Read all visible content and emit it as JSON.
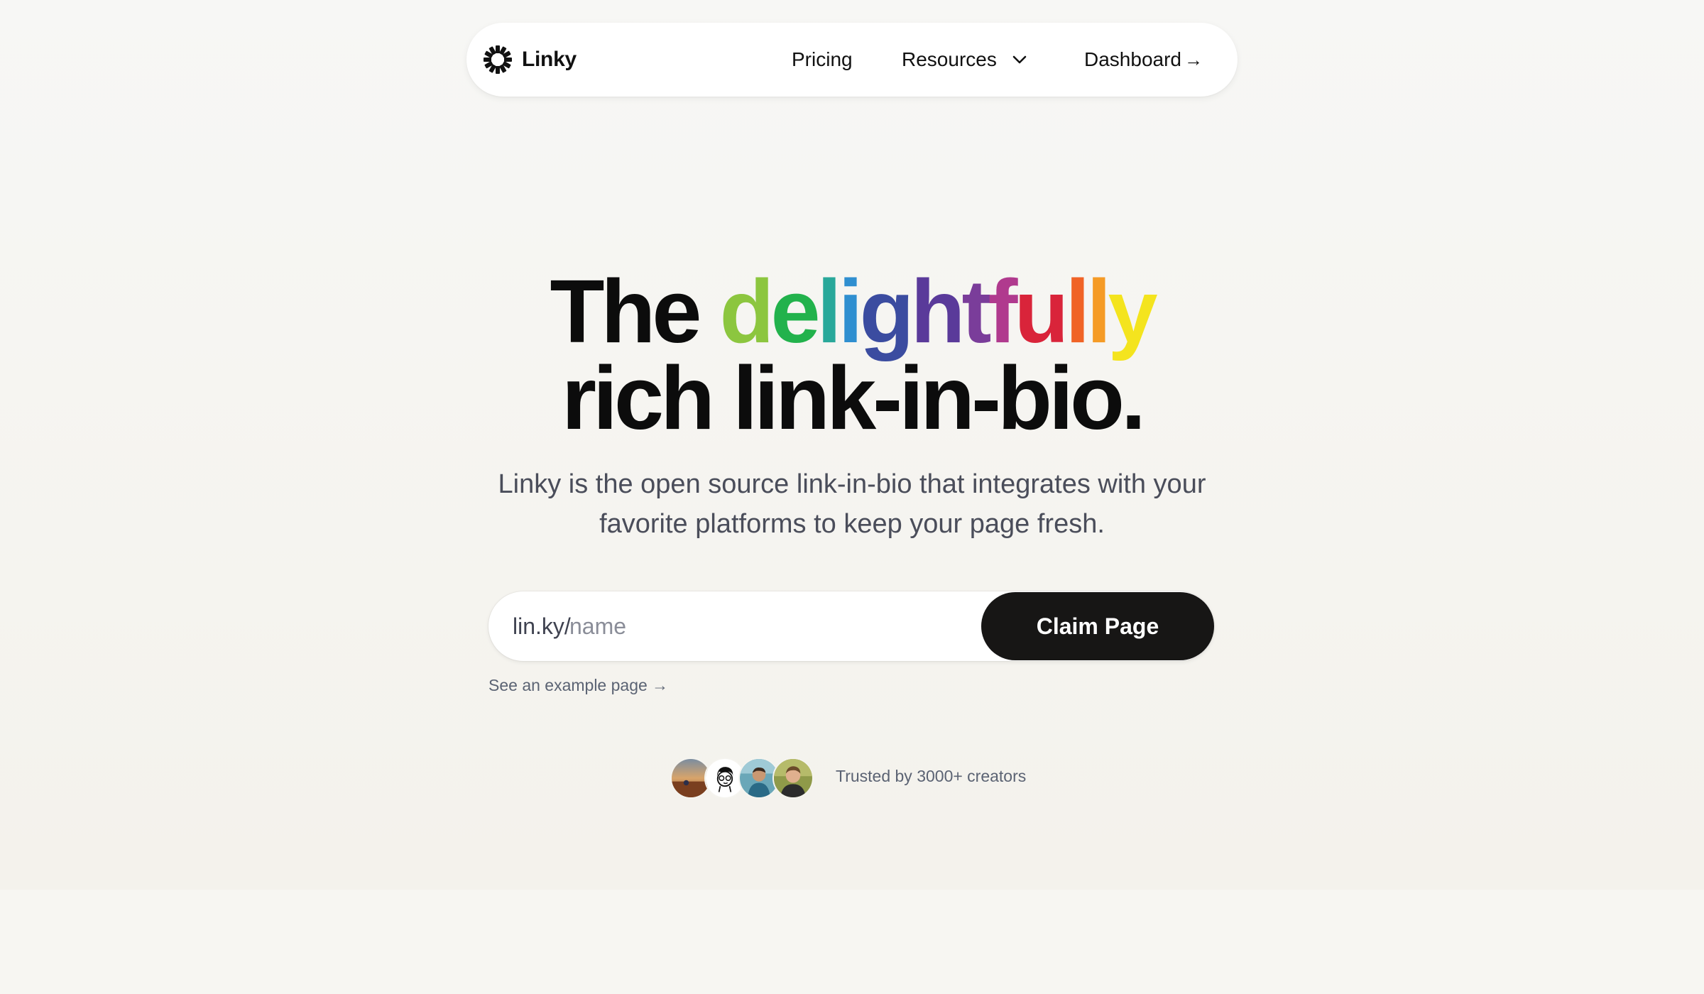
{
  "nav": {
    "brand": "Linky",
    "items": [
      {
        "label": "Pricing"
      },
      {
        "label": "Resources"
      },
      {
        "label": "Dashboard"
      }
    ],
    "dashboard_arrow": "→"
  },
  "hero": {
    "title_line1_prefix": "The ",
    "title_rainbow_word": "delightfully",
    "title_line2": "rich link-in-bio.",
    "rainbow_colors": [
      "#8cc63f",
      "#22b24c",
      "#29a89a",
      "#2f8fd0",
      "#3b4ca0",
      "#5a3a9a",
      "#7a3d9a",
      "#b03a8e",
      "#d9243a",
      "#f06326",
      "#f59b26",
      "#f4e41e"
    ],
    "subtitle_line1": "Linky is the open source link-in-bio that integrates with your",
    "subtitle_line2": "favorite platforms to keep your page fresh."
  },
  "claim": {
    "prefix": "lin.ky/",
    "placeholder": "name",
    "value": "",
    "button_label": "Claim Page"
  },
  "example_link": "See an example page →",
  "trust": {
    "text": "Trusted by 3000+ creators",
    "avatars": [
      "avatar-landscape",
      "avatar-cartoon",
      "avatar-person-beach",
      "avatar-person-portrait"
    ]
  },
  "colors": {
    "background": "#f7f6f2",
    "button": "#171615",
    "subtitle": "#4a4d5a",
    "muted": "#5b6373"
  }
}
